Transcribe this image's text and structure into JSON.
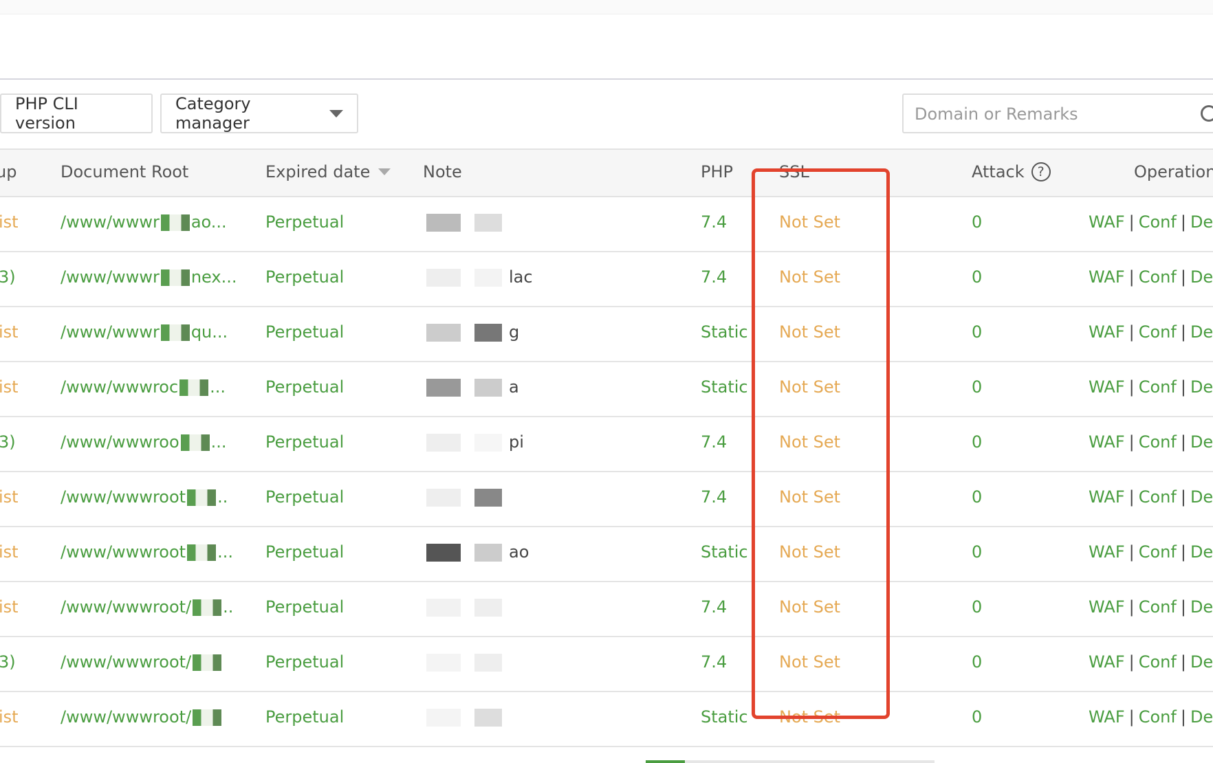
{
  "toolbar": {
    "php_cli_label": "PHP CLI version",
    "category_label": "Category manager",
    "search_placeholder": "Domain or Remarks"
  },
  "columns": {
    "group": "up",
    "doc_root": "Document Root",
    "expired": "Expired date",
    "note": "Note",
    "php": "PHP",
    "ssl": "SSL",
    "attack": "Attack",
    "attack_help": "?",
    "operation": "Operation"
  },
  "colors": {
    "accent_green": "#4a9d40",
    "warning_orange": "#e5a954",
    "highlight_red": "#e2432d"
  },
  "rows": [
    {
      "group": "ist",
      "group_color": "orange",
      "root": "/www/wwwr",
      "root_tail": "ao...",
      "expired": "Perpetual",
      "note": "",
      "php": "7.4",
      "ssl": "Not Set",
      "attack": "0"
    },
    {
      "group": "3)",
      "group_color": "green",
      "root": "/www/wwwr",
      "root_tail": "nex...",
      "expired": "Perpetual",
      "note": "lac",
      "php": "7.4",
      "ssl": "Not Set",
      "attack": "0"
    },
    {
      "group": "ist",
      "group_color": "orange",
      "root": "/www/wwwr",
      "root_tail": "qu...",
      "expired": "Perpetual",
      "note": "g",
      "php": "Static",
      "ssl": "Not Set",
      "attack": "0"
    },
    {
      "group": "ist",
      "group_color": "orange",
      "root": "/www/wwwroc",
      "root_tail": "...",
      "expired": "Perpetual",
      "note": "a",
      "php": "Static",
      "ssl": "Not Set",
      "attack": "0"
    },
    {
      "group": "3)",
      "group_color": "green",
      "root": "/www/wwwroo",
      "root_tail": "...",
      "expired": "Perpetual",
      "note": "pi",
      "php": "7.4",
      "ssl": "Not Set",
      "attack": "0"
    },
    {
      "group": "ist",
      "group_color": "orange",
      "root": "/www/wwwroot",
      "root_tail": "..",
      "expired": "Perpetual",
      "note": "",
      "php": "7.4",
      "ssl": "Not Set",
      "attack": "0"
    },
    {
      "group": "ist",
      "group_color": "orange",
      "root": "/www/wwwroot",
      "root_tail": "...",
      "expired": "Perpetual",
      "note": "ao",
      "php": "Static",
      "ssl": "Not Set",
      "attack": "0"
    },
    {
      "group": "ist",
      "group_color": "orange",
      "root": "/www/wwwroot/",
      "root_tail": "..",
      "expired": "Perpetual",
      "note": "",
      "php": "7.4",
      "ssl": "Not Set",
      "attack": "0"
    },
    {
      "group": "3)",
      "group_color": "green",
      "root": "/www/wwwroot/",
      "root_tail": "",
      "expired": "Perpetual",
      "note": "",
      "php": "7.4",
      "ssl": "Not Set",
      "attack": "0"
    },
    {
      "group": "ist",
      "group_color": "orange",
      "root": "/www/wwwroot/",
      "root_tail": "",
      "expired": "Perpetual",
      "note": "",
      "php": "Static",
      "ssl": "Not Set",
      "attack": "0"
    }
  ],
  "operations": {
    "waf": "WAF",
    "conf": "Conf",
    "del": "De",
    "sep": "|"
  }
}
